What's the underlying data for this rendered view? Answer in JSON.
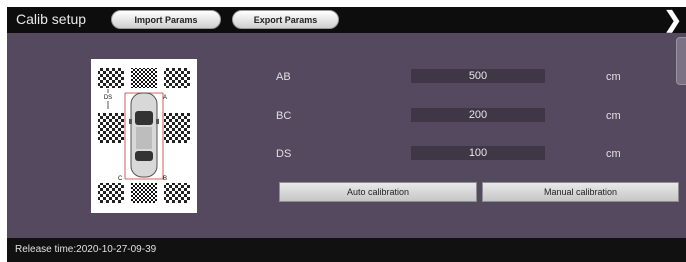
{
  "header": {
    "title": "Calib setup",
    "import_label": "Import Params",
    "export_label": "Export Params",
    "next_icon": "chevron-right-icon"
  },
  "diagram": {
    "labels": {
      "ds": "DS",
      "a": "A",
      "b": "B",
      "c": "C"
    }
  },
  "params": [
    {
      "label": "AB",
      "value": "500",
      "unit": "cm"
    },
    {
      "label": "BC",
      "value": "200",
      "unit": "cm"
    },
    {
      "label": "DS",
      "value": "100",
      "unit": "cm"
    }
  ],
  "actions": {
    "auto_label": "Auto calibration",
    "manual_label": "Manual calibration"
  },
  "footer": {
    "release": "Release time:2020-10-27-09-39"
  },
  "colors": {
    "panel": "#54495f",
    "bar": "#0d0d0d",
    "field": "#3f3646",
    "guide_line": "#c0392b"
  }
}
